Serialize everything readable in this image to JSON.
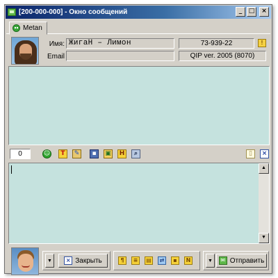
{
  "window": {
    "title": "[200-000-000] - Окно сообщений",
    "buttons": {
      "minimize": "_",
      "maximize": "□",
      "close": "×"
    }
  },
  "tab": {
    "label": "Metan",
    "icon": "green-alien-icon"
  },
  "contact": {
    "name_label": "Имя:",
    "name_value": "ЖигаН  –  Лимон",
    "email_label": "Email",
    "email_value": "",
    "uin": "73-939-22",
    "client": "QIP ver. 2005 (8070)"
  },
  "toolbar": {
    "counter": "0",
    "icons": [
      "smile-icon",
      "font-icon",
      "paint-icon",
      "save-icon",
      "image-icon",
      "h-icon",
      "find-icon"
    ],
    "right_icons": [
      "note-icon",
      "close-icon"
    ]
  },
  "bottom": {
    "close_label": "Закрыть",
    "send_label": "Отправить",
    "action_icons": [
      "translit-icon",
      "quote-icon",
      "phrases-icon",
      "file-transfer-icon",
      "contact-icon",
      "n-icon"
    ]
  },
  "colors": {
    "pane": "#c5e2de",
    "face": "#d4d0c8",
    "title_start": "#0a246a"
  }
}
